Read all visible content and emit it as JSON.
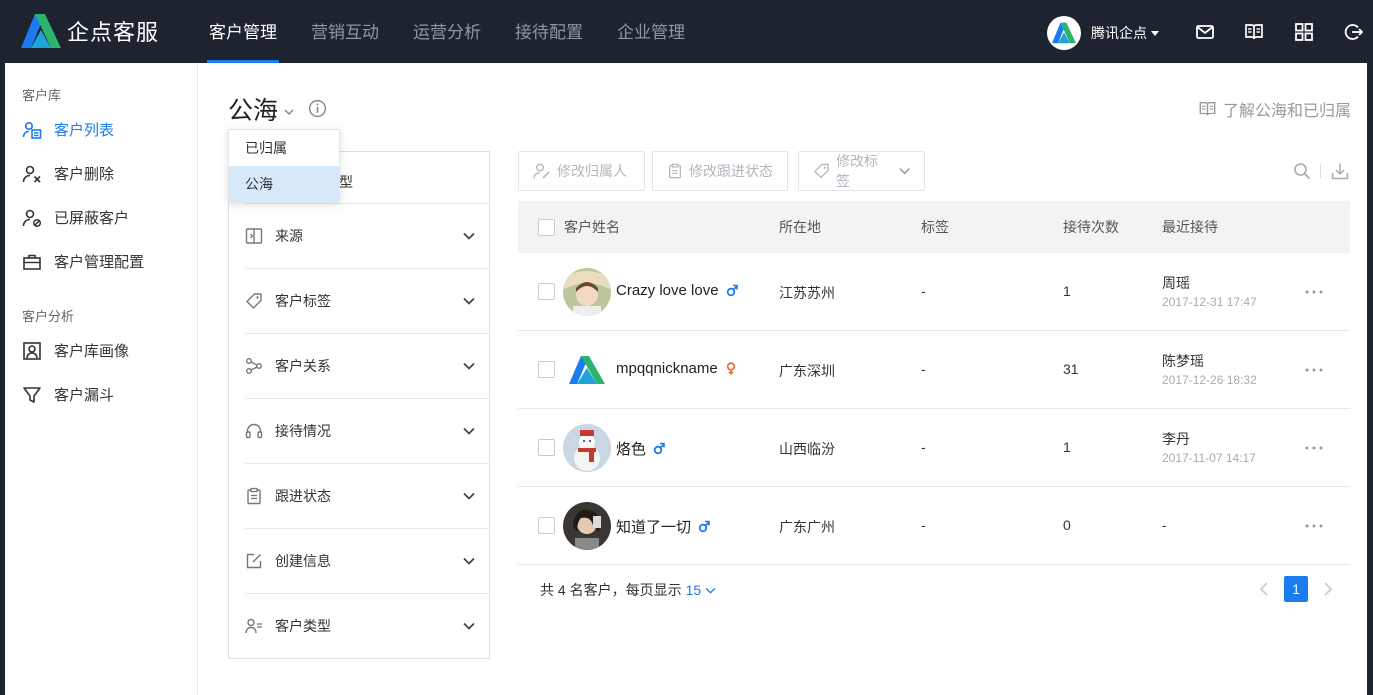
{
  "app": {
    "brand": "企点客服"
  },
  "nav": {
    "items": [
      "客户管理",
      "营销互动",
      "运营分析",
      "接待配置",
      "企业管理"
    ]
  },
  "user": {
    "name": "腾讯企点"
  },
  "sidebar": {
    "group1": "客户库",
    "items1": [
      "客户列表",
      "客户删除",
      "已屏蔽客户",
      "客户管理配置"
    ],
    "group2": "客户分析",
    "items2": [
      "客户库画像",
      "客户漏斗"
    ]
  },
  "page": {
    "title": "公海",
    "learn_link": "了解公海和已归属",
    "dropdown": [
      "已归属",
      "公海"
    ],
    "peek_char": "型"
  },
  "filters": [
    "来源",
    "客户标签",
    "客户关系",
    "接待情况",
    "跟进状态",
    "创建信息",
    "客户类型"
  ],
  "toolbar": {
    "assign": "修改归属人",
    "status": "修改跟进状态",
    "tag": "修改标签"
  },
  "table": {
    "headers": [
      "客户姓名",
      "所在地",
      "标签",
      "接待次数",
      "最近接待"
    ],
    "rows": [
      {
        "name": "Crazy love love",
        "gender": "male",
        "location": "江苏苏州",
        "tag": "-",
        "visits": "1",
        "agent": "周瑶",
        "time": "2017-12-31 17:47"
      },
      {
        "name": "mpqqnickname",
        "gender": "female",
        "location": "广东深圳",
        "tag": "-",
        "visits": "31",
        "agent": "陈梦瑶",
        "time": "2017-12-26 18:32"
      },
      {
        "name": "烙色",
        "gender": "male",
        "location": "山西临汾",
        "tag": "-",
        "visits": "1",
        "agent": "李丹",
        "time": "2017-11-07 14:17"
      },
      {
        "name": "知道了一切",
        "gender": "male",
        "location": "广东广州",
        "tag": "-",
        "visits": "0",
        "agent": "-",
        "time": ""
      }
    ]
  },
  "footer": {
    "summary": "共 4 名客户，每页显示",
    "page_size": "15",
    "current_page": "1"
  },
  "colors": {
    "accent": "#1b7cf0",
    "male": "#1b7cf0",
    "female": "#e8743b",
    "topbar": "#1e2330"
  }
}
